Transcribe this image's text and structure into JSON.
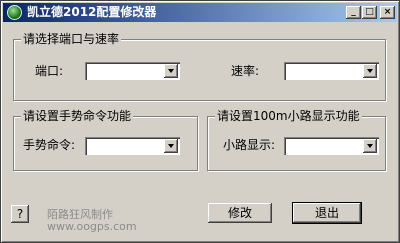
{
  "window": {
    "title": "凯立德2012配置修改器",
    "icon": "green-orb-icon",
    "controls": {
      "minimize": "_",
      "maximize": "□",
      "close": "×"
    }
  },
  "port_group": {
    "title": "请选择端口与速率",
    "port_label": "端口:",
    "port_value": "",
    "rate_label": "速率:",
    "rate_value": ""
  },
  "gesture_group": {
    "title": "请设置手势命令功能",
    "gesture_label": "手势命令:",
    "gesture_value": ""
  },
  "route_group": {
    "title": "请设置100m小路显示功能",
    "route_label": "小路显示:",
    "route_value": ""
  },
  "footer": {
    "help_label": "?",
    "credit": "陌路狂风制作",
    "website": "www.oogps.com",
    "modify_label": "修改",
    "exit_label": "退出"
  }
}
